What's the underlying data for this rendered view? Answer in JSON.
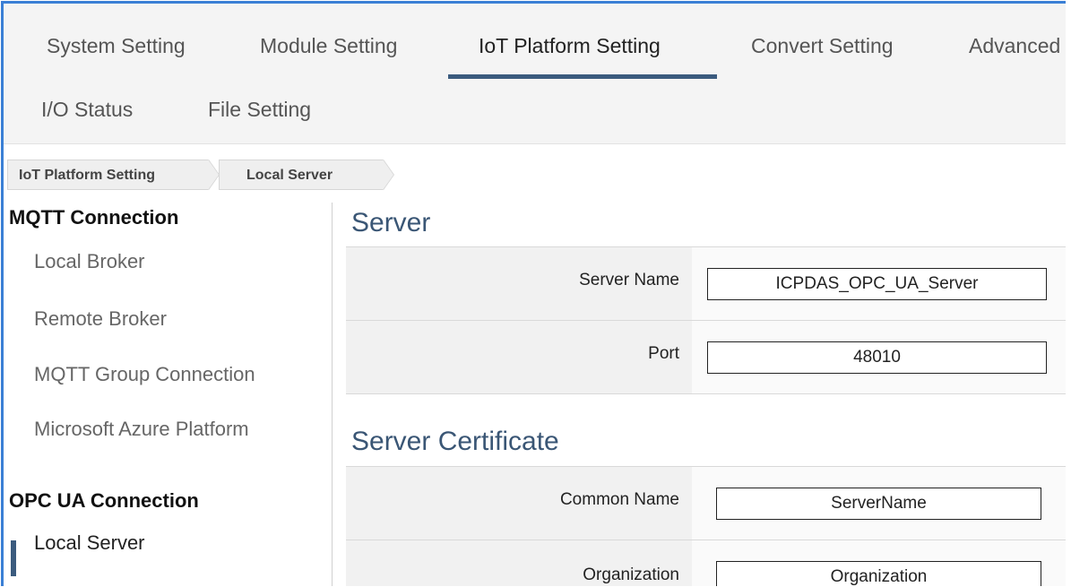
{
  "tabs": [
    {
      "label": "System Setting"
    },
    {
      "label": "Module Setting"
    },
    {
      "label": "IoT Platform Setting"
    },
    {
      "label": "Convert Setting"
    },
    {
      "label": "Advanced"
    },
    {
      "label": "I/O Status"
    },
    {
      "label": "File Setting"
    }
  ],
  "active_tab": "IoT Platform Setting",
  "breadcrumb": [
    "IoT Platform Setting",
    "Local Server"
  ],
  "sidebar": {
    "groups": [
      {
        "title": "MQTT Connection",
        "items": [
          "Local Broker",
          "Remote Broker",
          "MQTT Group Connection",
          "Microsoft Azure Platform"
        ]
      },
      {
        "title": "OPC UA Connection",
        "items": [
          "Local Server"
        ]
      }
    ],
    "active_item": "Local Server"
  },
  "server": {
    "title": "Server",
    "fields": [
      {
        "label": "Server Name",
        "value": "ICPDAS_OPC_UA_Server"
      },
      {
        "label": "Port",
        "value": "48010"
      }
    ]
  },
  "certificate": {
    "title": "Server Certificate",
    "fields": [
      {
        "label": "Common Name",
        "value": "ServerName"
      },
      {
        "label": "Organization",
        "value": "Organization"
      }
    ]
  },
  "colors": {
    "accent": "#3b5b7e",
    "frame": "#3a7fd5",
    "section_title": "#3a5675"
  }
}
